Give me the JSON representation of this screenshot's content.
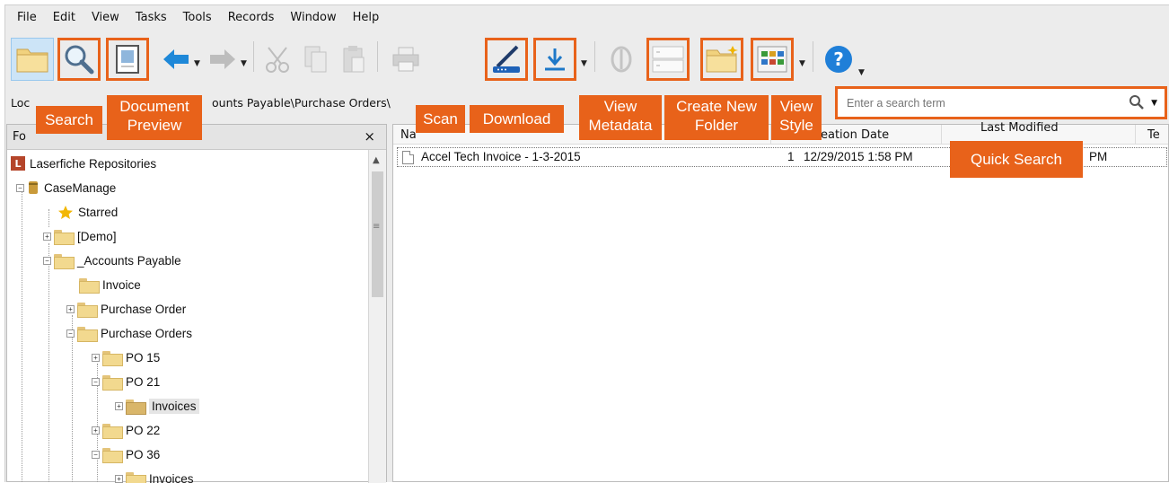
{
  "menu": [
    "File",
    "Edit",
    "View",
    "Tasks",
    "Tools",
    "Records",
    "Window",
    "Help"
  ],
  "address": {
    "label": "Loc",
    "path": "ounts Payable\\Purchase Orders\\"
  },
  "search": {
    "placeholder": "Enter a search term"
  },
  "callouts": {
    "search": "Search",
    "document_preview_1": "Document",
    "document_preview_2": "Preview",
    "scan": "Scan",
    "download": "Download",
    "view_metadata_1": "View",
    "view_metadata_2": "Metadata",
    "create_folder_1": "Create New",
    "create_folder_2": "Folder",
    "view_style_1": "View",
    "view_style_2": "Style",
    "quick_search": "Quick Search"
  },
  "folder_pane": {
    "title": "Fo",
    "close": "×",
    "tree": [
      {
        "label": "Laserfiche Repositories",
        "icon": "repository-icon"
      },
      {
        "label": "CaseManage",
        "icon": "database-icon"
      },
      {
        "label": "Starred",
        "icon": "star-icon"
      },
      {
        "label": "[Demo]",
        "icon": "folder-icon"
      },
      {
        "label": "_Accounts Payable",
        "icon": "folder-icon"
      },
      {
        "label": "Invoice",
        "icon": "folder-icon"
      },
      {
        "label": "Purchase Order",
        "icon": "folder-icon"
      },
      {
        "label": "Purchase Orders",
        "icon": "folder-icon"
      },
      {
        "label": "PO 15",
        "icon": "folder-icon"
      },
      {
        "label": "PO 21",
        "icon": "folder-icon"
      },
      {
        "label": "Invoices",
        "icon": "folder-icon"
      },
      {
        "label": "PO 22",
        "icon": "folder-icon"
      },
      {
        "label": "PO 36",
        "icon": "folder-icon"
      },
      {
        "label": "Invoices",
        "icon": "folder-icon"
      }
    ]
  },
  "list": {
    "columns": {
      "name": "Na",
      "creation": "eation Date",
      "modified": "Last Modified",
      "te": "Te"
    },
    "rows": [
      {
        "name": "Accel Tech Invoice - 1-3-2015",
        "pages": "1",
        "created": "12/29/2015 1:58 PM",
        "modified": "PM"
      }
    ]
  },
  "colors": {
    "highlight": "#e8621a",
    "arrow_blue": "#1e88d8",
    "help_blue": "#1f7fd8"
  }
}
